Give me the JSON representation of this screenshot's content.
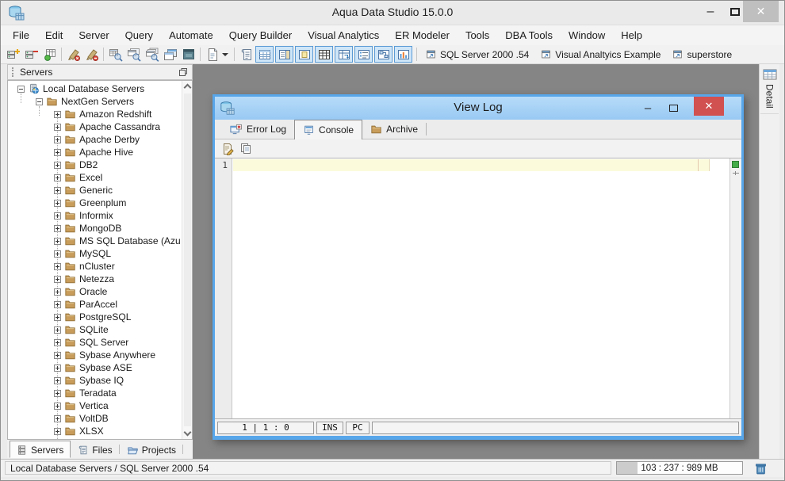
{
  "window": {
    "title": "Aqua Data Studio 15.0.0",
    "controls": {
      "minimize": "–",
      "close": "✕"
    }
  },
  "menu": {
    "items": [
      "File",
      "Edit",
      "Server",
      "Query",
      "Automate",
      "Query Builder",
      "Visual Analytics",
      "ER Modeler",
      "Tools",
      "DBA Tools",
      "Window",
      "Help"
    ]
  },
  "toolbar": {
    "icon_buttons": [
      "register-server",
      "unregister-server",
      "connect-table",
      "cleanup-brush",
      "cleanup-brush-remove",
      "find-table",
      "find-table-window",
      "find-table-windows",
      "cascade-windows",
      "window-stack",
      "new-file",
      "log-viewer"
    ],
    "view_buttons": [
      "grid-view",
      "form-view",
      "document-view",
      "table-view",
      "pivot-view",
      "list-view",
      "er-diagram-view",
      "chart-view"
    ],
    "window_buttons": [
      {
        "label": "SQL Server 2000 .54",
        "icon": "window"
      },
      {
        "label": "Visual Analtyics Example",
        "icon": "window"
      },
      {
        "label": "superstore",
        "icon": "window"
      }
    ]
  },
  "servers_panel": {
    "title": "Servers",
    "tree": {
      "items": [
        {
          "label": "Local Database Servers",
          "level": 0,
          "expand": "minus",
          "icon": "server-globe"
        },
        {
          "label": "NextGen Servers",
          "level": 1,
          "expand": "minus",
          "icon": "folder"
        },
        {
          "label": "Amazon Redshift",
          "level": 2,
          "expand": "plus",
          "icon": "folder"
        },
        {
          "label": "Apache Cassandra",
          "level": 2,
          "expand": "plus",
          "icon": "folder"
        },
        {
          "label": "Apache Derby",
          "level": 2,
          "expand": "plus",
          "icon": "folder"
        },
        {
          "label": "Apache Hive",
          "level": 2,
          "expand": "plus",
          "icon": "folder"
        },
        {
          "label": "DB2",
          "level": 2,
          "expand": "plus",
          "icon": "folder"
        },
        {
          "label": "Excel",
          "level": 2,
          "expand": "plus",
          "icon": "folder"
        },
        {
          "label": "Generic",
          "level": 2,
          "expand": "plus",
          "icon": "folder"
        },
        {
          "label": "Greenplum",
          "level": 2,
          "expand": "plus",
          "icon": "folder"
        },
        {
          "label": "Informix",
          "level": 2,
          "expand": "plus",
          "icon": "folder"
        },
        {
          "label": "MongoDB",
          "level": 2,
          "expand": "plus",
          "icon": "folder"
        },
        {
          "label": "MS SQL Database (Azure)",
          "level": 2,
          "expand": "plus",
          "icon": "folder"
        },
        {
          "label": "MySQL",
          "level": 2,
          "expand": "plus",
          "icon": "folder"
        },
        {
          "label": "nCluster",
          "level": 2,
          "expand": "plus",
          "icon": "folder"
        },
        {
          "label": "Netezza",
          "level": 2,
          "expand": "plus",
          "icon": "folder"
        },
        {
          "label": "Oracle",
          "level": 2,
          "expand": "plus",
          "icon": "folder"
        },
        {
          "label": "ParAccel",
          "level": 2,
          "expand": "plus",
          "icon": "folder"
        },
        {
          "label": "PostgreSQL",
          "level": 2,
          "expand": "plus",
          "icon": "folder"
        },
        {
          "label": "SQLite",
          "level": 2,
          "expand": "plus",
          "icon": "folder"
        },
        {
          "label": "SQL Server",
          "level": 2,
          "expand": "plus",
          "icon": "folder"
        },
        {
          "label": "Sybase Anywhere",
          "level": 2,
          "expand": "plus",
          "icon": "folder"
        },
        {
          "label": "Sybase ASE",
          "level": 2,
          "expand": "plus",
          "icon": "folder"
        },
        {
          "label": "Sybase IQ",
          "level": 2,
          "expand": "plus",
          "icon": "folder"
        },
        {
          "label": "Teradata",
          "level": 2,
          "expand": "plus",
          "icon": "folder"
        },
        {
          "label": "Vertica",
          "level": 2,
          "expand": "plus",
          "icon": "folder"
        },
        {
          "label": "VoltDB",
          "level": 2,
          "expand": "plus",
          "icon": "folder"
        },
        {
          "label": "XLSX",
          "level": 2,
          "expand": "plus",
          "icon": "folder"
        },
        {
          "label": "",
          "level": 2,
          "expand": "plus",
          "icon": "folder"
        }
      ]
    },
    "tabs": [
      {
        "label": "Servers",
        "icon": "servers",
        "active": true
      },
      {
        "label": "Files",
        "icon": "files",
        "active": false
      },
      {
        "label": "Projects",
        "icon": "projects",
        "active": false
      }
    ]
  },
  "detail_panel": {
    "label": "Detail"
  },
  "dialog": {
    "title": "View Log",
    "controls": {
      "minimize": "–",
      "close": "✕"
    },
    "tabs": [
      {
        "label": "Error Log",
        "icon": "error-log",
        "active": false
      },
      {
        "label": "Console",
        "icon": "console",
        "active": true
      },
      {
        "label": "Archive",
        "icon": "archive",
        "active": false
      }
    ],
    "toolbar_icons": [
      "edit-document",
      "copy"
    ],
    "editor": {
      "line_number": "1"
    },
    "status": {
      "caret": "1 | 1 : 0",
      "insert_mode": "INS",
      "encoding": "PC"
    }
  },
  "status_bar": {
    "context": "Local Database Servers / SQL Server 2000 .54",
    "memory": "103 : 237 : 989 MB"
  },
  "colors": {
    "dialog_border": "#58a6ea",
    "dialog_titlebar": "#a9d3f5",
    "close_red": "#d15050",
    "folder_tan": "#c89c5a",
    "view_button_bg": "#cfe6f8",
    "view_button_border": "#5b9bd5",
    "marker_green": "#44ad49",
    "current_line": "#fbfbdc",
    "mdi_background": "#858585"
  }
}
